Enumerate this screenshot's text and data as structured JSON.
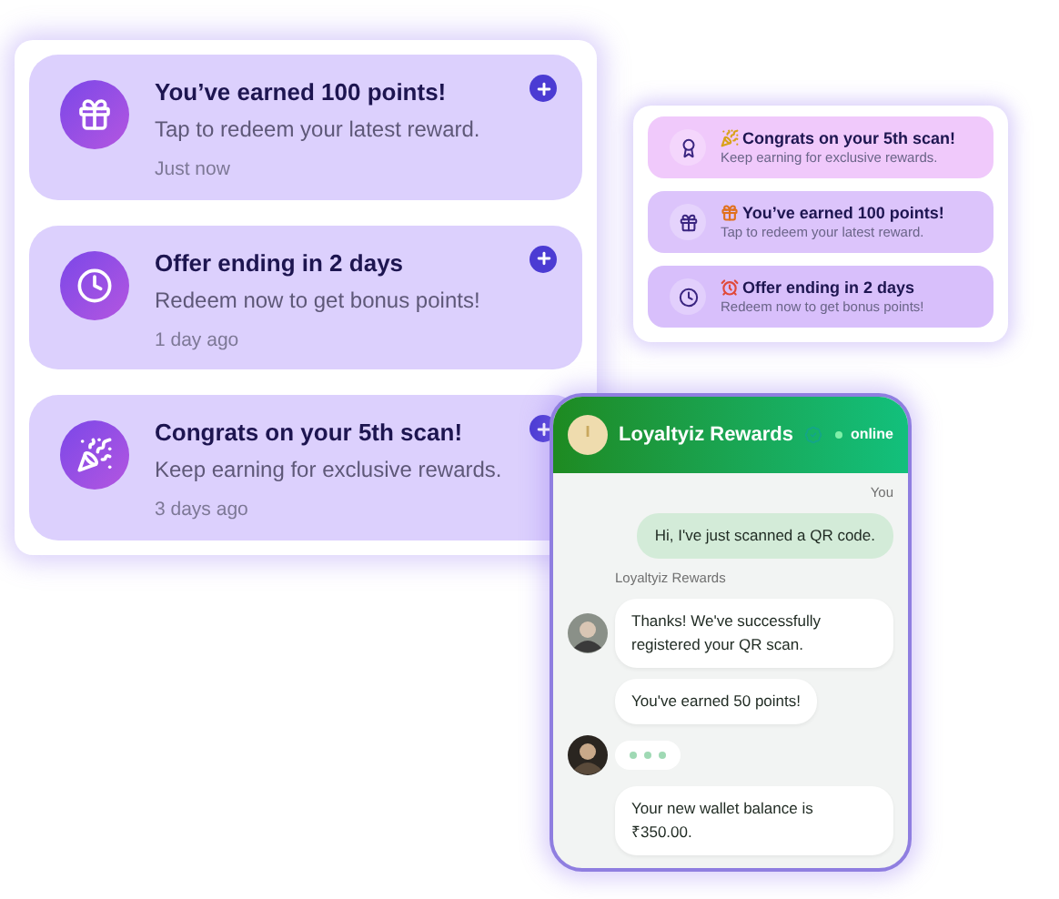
{
  "notifications": [
    {
      "kind": "gift",
      "title": "You’ve earned 100 points!",
      "message": "Tap to redeem your latest reward.",
      "time": "Just now"
    },
    {
      "kind": "clock",
      "title": "Offer ending in 2 days",
      "message": "Redeem now to get bonus points!",
      "time": "1 day ago"
    },
    {
      "kind": "party",
      "title": "Congrats on your 5th scan!",
      "message": "Keep earning for exclusive rewards.",
      "time": "3 days ago"
    }
  ],
  "mini_notifications": [
    {
      "kind": "award",
      "title": "Congrats on your 5th scan!",
      "message": "Keep earning for exclusive rewards.",
      "color": "#f0c9fb"
    },
    {
      "kind": "gift",
      "title": "You’ve earned 100 points!",
      "message": "Tap to redeem your latest reward.",
      "color": "#dcc4fb"
    },
    {
      "kind": "clock",
      "title": "Offer ending in 2 days",
      "message": "Redeem now to get bonus points!",
      "color": "#d8bffb"
    }
  ],
  "chat": {
    "title": "Loyaltyiz Rewards",
    "status": "online",
    "messages": [
      {
        "kind": "sent",
        "label": "You",
        "text": "Hi, I've just scanned a QR code."
      },
      {
        "kind": "received",
        "label": "Loyaltyiz Rewards",
        "text": "Thanks! We've successfully registered your QR scan.",
        "avatar": true
      },
      {
        "kind": "received",
        "text": "You've earned 50 points!",
        "avatar": false
      },
      {
        "kind": "typing",
        "avatar": true
      },
      {
        "kind": "received",
        "text": "Your new wallet balance is ₹350.00.",
        "avatar": false
      }
    ]
  }
}
